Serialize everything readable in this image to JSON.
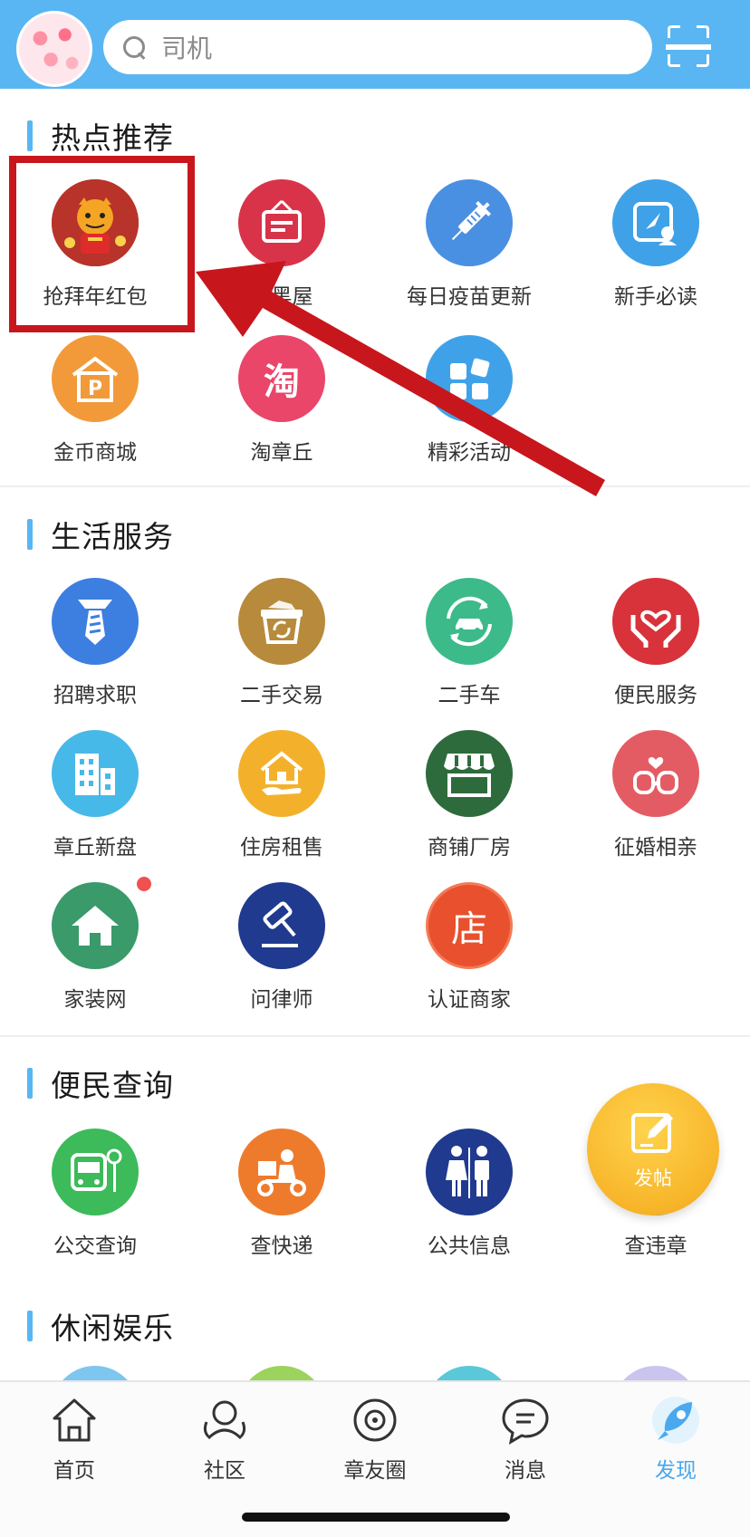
{
  "header": {
    "search_placeholder": "司机"
  },
  "sections": {
    "hot": {
      "title": "热点推荐",
      "items": [
        {
          "label": "抢拜年红包",
          "icon": "tiger-red-envelope-icon",
          "color": "#c0392b"
        },
        {
          "label": "小黑屋",
          "icon": "sign-board-icon",
          "color": "#d9334a"
        },
        {
          "label": "每日疫苗更新",
          "icon": "syringe-icon",
          "color": "#4a90e2"
        },
        {
          "label": "新手必读",
          "icon": "guide-compass-icon",
          "color": "#3fa2e8"
        },
        {
          "label": "金币商城",
          "icon": "mall-p-icon",
          "color": "#f29a3a"
        },
        {
          "label": "淘章丘",
          "icon": "tao-shopping-icon",
          "color": "#e9466a"
        },
        {
          "label": "精彩活动",
          "icon": "blocks-icon",
          "color": "#3fa2e8"
        }
      ]
    },
    "life": {
      "title": "生活服务",
      "items": [
        {
          "label": "招聘求职",
          "icon": "tie-icon",
          "color": "#3d7fe0"
        },
        {
          "label": "二手交易",
          "icon": "basket-recycle-icon",
          "color": "#b78a3c"
        },
        {
          "label": "二手车",
          "icon": "car-recycle-icon",
          "color": "#3dba8a"
        },
        {
          "label": "便民服务",
          "icon": "heart-hands-icon",
          "color": "#d8323a"
        },
        {
          "label": "章丘新盘",
          "icon": "building-icon",
          "color": "#47b9e8"
        },
        {
          "label": "住房租售",
          "icon": "house-hand-icon",
          "color": "#f3b12b"
        },
        {
          "label": "商铺厂房",
          "icon": "storefront-icon",
          "color": "#2e6b3c"
        },
        {
          "label": "征婚相亲",
          "icon": "couple-heart-icon",
          "color": "#e35c64"
        },
        {
          "label": "家装网",
          "icon": "home-icon",
          "color": "#3a9a6a"
        },
        {
          "label": "问律师",
          "icon": "gavel-icon",
          "color": "#1f3a8f"
        },
        {
          "label": "认证商家",
          "icon": "shop-badge-icon",
          "color": "#e8502e",
          "glyph": "店"
        }
      ]
    },
    "query": {
      "title": "便民查询",
      "items": [
        {
          "label": "公交查询",
          "icon": "bus-icon",
          "color": "#3dba5a"
        },
        {
          "label": "查快递",
          "icon": "courier-icon",
          "color": "#ee7b2c"
        },
        {
          "label": "公共信息",
          "icon": "restroom-icon",
          "color": "#1f3a8f"
        },
        {
          "label": "查违章",
          "icon": "traffic-ticket-icon",
          "color": "#3fa2e8"
        }
      ]
    },
    "leisure": {
      "title": "休闲娱乐"
    }
  },
  "post_button": {
    "label": "发帖"
  },
  "tao_glyph": "淘",
  "bottom_nav": [
    {
      "label": "首页",
      "icon": "home-outline-icon"
    },
    {
      "label": "社区",
      "icon": "community-icon"
    },
    {
      "label": "章友圈",
      "icon": "planet-icon"
    },
    {
      "label": "消息",
      "icon": "chat-bubble-icon"
    },
    {
      "label": "发现",
      "icon": "rocket-icon",
      "active": true
    }
  ],
  "colors": {
    "accent": "#5ab6f2",
    "highlight": "#c8161d",
    "nav_active": "#4aa8ee"
  }
}
